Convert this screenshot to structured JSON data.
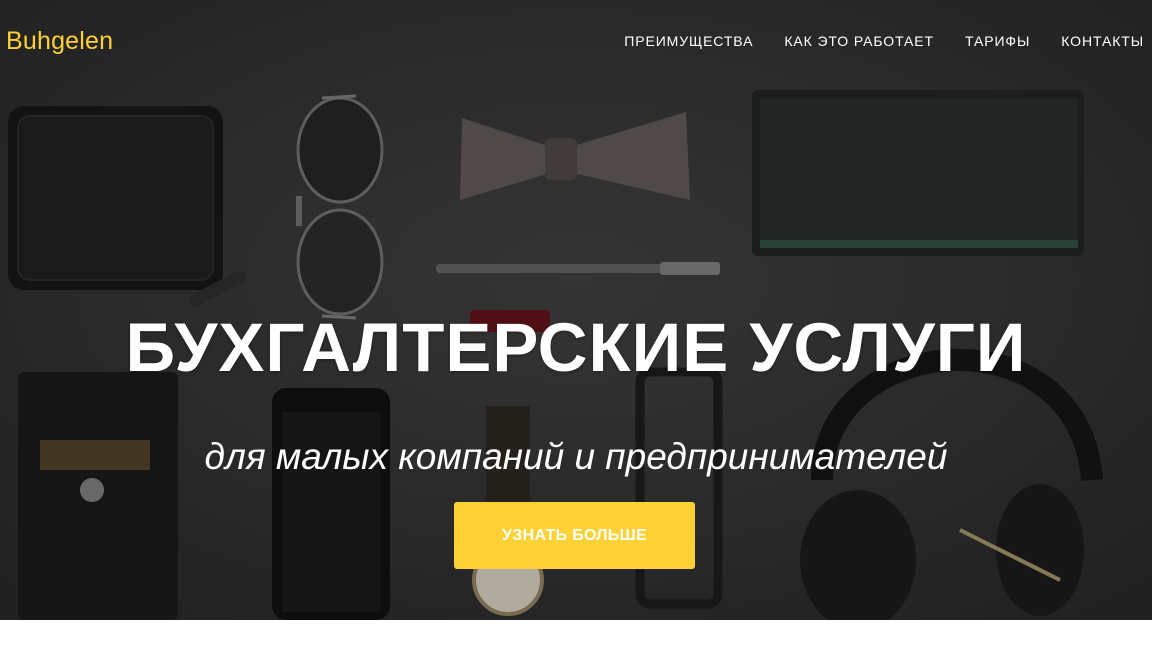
{
  "brand": {
    "name": "Buhgelen",
    "color": "#fed136"
  },
  "nav": {
    "items": [
      {
        "label": "ПРЕИМУЩЕСТВА"
      },
      {
        "label": "КАК ЭТО РАБОТАЕТ"
      },
      {
        "label": "ТАРИФЫ"
      },
      {
        "label": "КОНТАКТЫ"
      }
    ]
  },
  "hero": {
    "title": "БУХГАЛТЕРСКИЕ УСЛУГИ",
    "subtitle": "для малых компаний и предпринимателей",
    "cta_label": "УЗНАТЬ БОЛЬШЕ",
    "background_image": "flat-lay-of-mens-accessories",
    "accent_color": "#fed136"
  }
}
